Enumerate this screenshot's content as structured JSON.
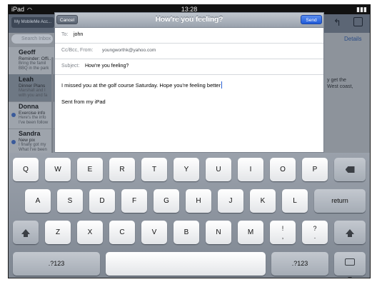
{
  "status": {
    "device": "iPad",
    "time": "13:28"
  },
  "background": {
    "mailbox_button": "My MobileMe Acc...",
    "search_placeholder": "Search Inbox",
    "details": "Details",
    "detail_text": "y get the\nWest coast,",
    "messages": [
      {
        "name": "Geoff",
        "subject": "Reminder: Offi...",
        "preview": "Bring the famil\nBBQ in the park",
        "unread": false
      },
      {
        "name": "Leah",
        "subject": "Dinner Plans",
        "preview": "Marshall and I\nwith you and fa",
        "unread": false
      },
      {
        "name": "Donna",
        "subject": "Exercise info",
        "preview": "Here's the info\nI've been follow",
        "unread": true
      },
      {
        "name": "Sandra",
        "subject": "New pix",
        "preview": "I finally got my\nWhat I've been",
        "unread": true
      }
    ]
  },
  "compose": {
    "title": "How're you feeling?",
    "cancel_label": "Cancel",
    "send_label": "Send",
    "to_label": "To:",
    "to_value": "john",
    "cc_label": "Cc/Bcc, From:",
    "cc_value": "youngworthk@yahoo.com",
    "subject_label": "Subject:",
    "subject_value": "How're you feeling?",
    "body": "I missed you at the golf course Saturday. Hope you're feeling better",
    "signature": "Sent from my iPad"
  },
  "keyboard": {
    "row1": [
      "Q",
      "W",
      "E",
      "R",
      "T",
      "Y",
      "U",
      "I",
      "O",
      "P"
    ],
    "row2": [
      "A",
      "S",
      "D",
      "F",
      "G",
      "H",
      "J",
      "K",
      "L"
    ],
    "return_label": "return",
    "row3": [
      "Z",
      "X",
      "C",
      "V",
      "B",
      "N",
      "M"
    ],
    "excl_top": "!",
    "excl_bottom": ",",
    "quest_top": "?",
    "quest_bottom": ".",
    "numbers_label": ".?123"
  }
}
